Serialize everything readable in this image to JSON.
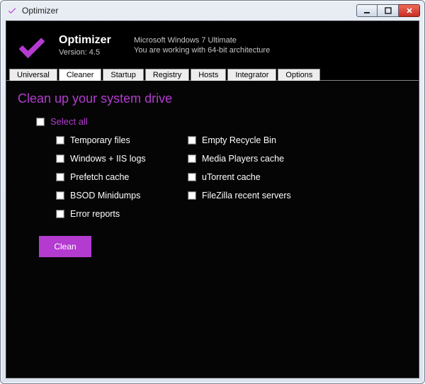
{
  "window": {
    "title": "Optimizer"
  },
  "header": {
    "app_name": "Optimizer",
    "version_label": "Version: 4.5",
    "os_line": "Microsoft Windows 7 Ultimate",
    "arch_line": "You are working with 64-bit architecture"
  },
  "tabs": {
    "items": [
      "Universal",
      "Cleaner",
      "Startup",
      "Registry",
      "Hosts",
      "Integrator",
      "Options"
    ],
    "active_index": 1
  },
  "cleaner": {
    "heading": "Clean up your system drive",
    "select_all_label": "Select all",
    "options_left": [
      "Temporary files",
      "Windows + IIS logs",
      "Prefetch cache",
      "BSOD Minidumps",
      "Error reports"
    ],
    "options_right": [
      "Empty Recycle Bin",
      "Media Players cache",
      "uTorrent cache",
      "FileZilla recent servers"
    ],
    "clean_button": "Clean"
  },
  "colors": {
    "accent": "#b43bd0"
  }
}
